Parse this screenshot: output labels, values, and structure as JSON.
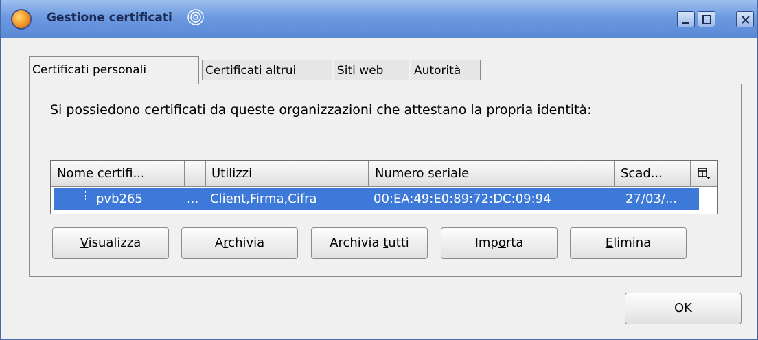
{
  "window": {
    "title": "Gestione certificati",
    "app_icon": "firefox-icon",
    "title_accent_icon": "swirl-icon",
    "controls": [
      "minimize-icon",
      "maximize-icon",
      "close-icon"
    ]
  },
  "tabs": [
    {
      "label": "Certificati personali",
      "active": true
    },
    {
      "label": "Certificati altrui",
      "active": false
    },
    {
      "label": "Siti web",
      "active": false
    },
    {
      "label": "Autorità",
      "active": false
    }
  ],
  "panel": {
    "description": "Si possiedono certificati da queste organizzazioni che attestano la propria identità:"
  },
  "table": {
    "columns": [
      "Nome certifi...",
      "",
      "Utilizzi",
      "Numero seriale",
      "Scad..."
    ],
    "column_picker_icon": "column-picker-icon",
    "rows": [
      {
        "name": "pvb265",
        "extra": "...",
        "uses": "Client,Firma,Cifra",
        "serial": "00:EA:49:E0:89:72:DC:09:94",
        "expiry": "27/03/...",
        "selected": true
      }
    ]
  },
  "buttons": {
    "view": {
      "pre": "",
      "mn": "V",
      "post": "isualizza"
    },
    "backup": {
      "pre": "A",
      "mn": "r",
      "post": "chivia"
    },
    "backup_all": {
      "pre": "Archivia ",
      "mn": "t",
      "post": "utti"
    },
    "import": {
      "pre": "Imp",
      "mn": "o",
      "post": "rta"
    },
    "delete": {
      "pre": "",
      "mn": "E",
      "post": "limina"
    }
  },
  "ok_label": "OK",
  "colors": {
    "selection": "#3d79d8",
    "titlebar": "#6d9ae0"
  }
}
